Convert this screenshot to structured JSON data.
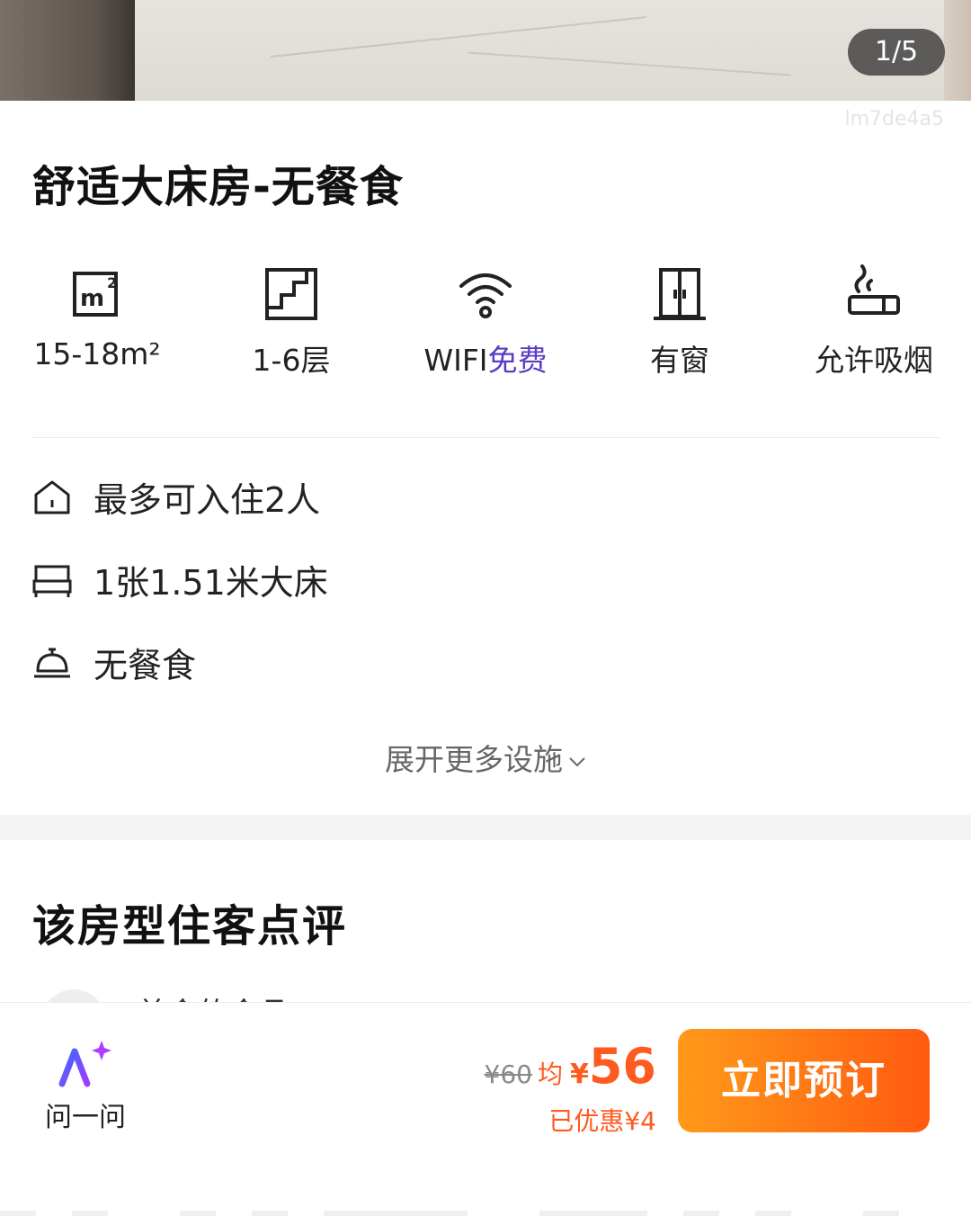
{
  "gallery": {
    "counter": "1/5",
    "watermark": "lm7de4a5"
  },
  "room": {
    "title": "舒适大床房-无餐食"
  },
  "facilities": [
    {
      "icon": "area-icon",
      "label": "15-18m²"
    },
    {
      "icon": "floor-icon",
      "label": "1-6层"
    },
    {
      "icon": "wifi-icon",
      "label_main": "WIFI",
      "label_accent": "免费"
    },
    {
      "icon": "window-icon",
      "label": "有窗"
    },
    {
      "icon": "smoking-icon",
      "label": "允许吸烟"
    }
  ],
  "info": [
    {
      "icon": "home-icon",
      "text": "最多可入住2人"
    },
    {
      "icon": "bed-icon",
      "text": "1张1.51米大床"
    },
    {
      "icon": "meal-bell-icon",
      "text": "无餐食"
    }
  ],
  "expand_label": "展开更多设施",
  "reviews": {
    "title": "该房型住客点评",
    "first_reviewer": "美食的食品"
  },
  "bottom_bar": {
    "ask_label": "问一问",
    "original_price": "¥60",
    "avg_label": "均",
    "currency": "¥",
    "price": "56",
    "discount": "已优惠¥4",
    "book_label": "立即预订"
  },
  "colors": {
    "accent": "#5a3cc4",
    "price": "#ff5a1f",
    "button_start": "#ff9a1a",
    "button_end": "#ff5a10"
  }
}
